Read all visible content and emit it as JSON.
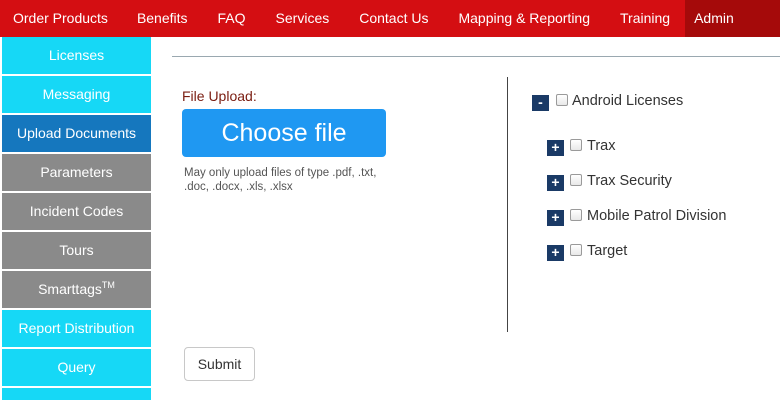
{
  "nav": {
    "order_products": "Order Products",
    "benefits": "Benefits",
    "faq": "FAQ",
    "services": "Services",
    "contact_us": "Contact Us",
    "mapping_reporting": "Mapping & Reporting",
    "training": "Training",
    "admin": "Admin"
  },
  "sidebar": {
    "licenses": "Licenses",
    "messaging": "Messaging",
    "upload_documents": "Upload Documents",
    "parameters": "Parameters",
    "incident_codes": "Incident Codes",
    "tours": "Tours",
    "smarttags": "Smarttags",
    "smarttags_tm": "TM",
    "report_distribution": "Report Distribution",
    "query": "Query"
  },
  "upload": {
    "label": "File Upload:",
    "choose_button": "Choose file",
    "hint": "May only upload files of type .pdf, .txt, .doc, .docx, .xls, .xlsx"
  },
  "tree": {
    "root": {
      "toggle": "-",
      "label": "Android Licenses",
      "checked": false
    },
    "children": [
      {
        "toggle": "+",
        "label": "Trax",
        "checked": false
      },
      {
        "toggle": "+",
        "label": "Trax Security",
        "checked": false
      },
      {
        "toggle": "+",
        "label": "Mobile Patrol Division",
        "checked": false
      },
      {
        "toggle": "+",
        "label": "Target",
        "checked": false
      }
    ]
  },
  "submit_label": "Submit",
  "colors": {
    "nav_bg": "#d40e12",
    "admin_bg": "#a50a0a",
    "sidebar_cyan": "#16d8f6",
    "sidebar_gray": "#8a8a8a",
    "sidebar_active": "#1577be",
    "choose_button": "#1f98f2",
    "tree_toggle": "#1a3a66"
  }
}
